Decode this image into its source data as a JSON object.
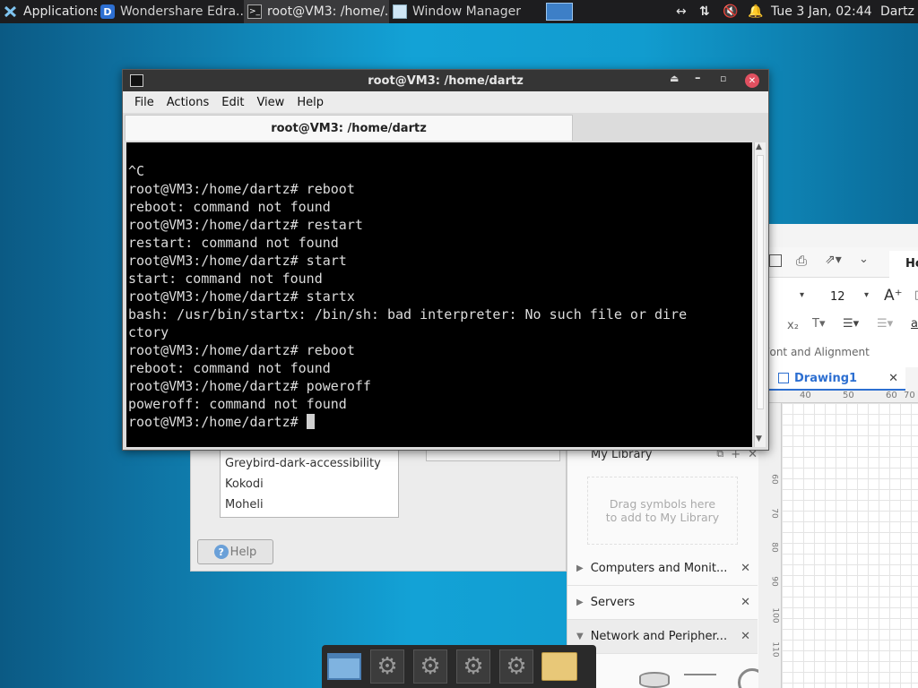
{
  "panel": {
    "applications": "Applications",
    "tasks": [
      {
        "label": "Wondershare Edra..."
      },
      {
        "label": "root@VM3: /home/..."
      },
      {
        "label": "Window Manager"
      }
    ],
    "clock": "Tue  3 Jan, 02:44",
    "user": "Dartz"
  },
  "terminal": {
    "window_title": "root@VM3: /home/dartz",
    "tab_title": "root@VM3: /home/dartz",
    "menu": [
      "File",
      "Actions",
      "Edit",
      "View",
      "Help"
    ],
    "lines": [
      "",
      "^C",
      "root@VM3:/home/dartz# reboot",
      "reboot: command not found",
      "root@VM3:/home/dartz# restart",
      "restart: command not found",
      "root@VM3:/home/dartz# start",
      "start: command not found",
      "root@VM3:/home/dartz# startx",
      "bash: /usr/bin/startx: /bin/sh: bad interpreter: No such file or dire",
      "ctory",
      "root@VM3:/home/dartz# reboot",
      "reboot: command not found",
      "root@VM3:/home/dartz# poweroff",
      "poweroff: command not found"
    ],
    "prompt": "root@VM3:/home/dartz# "
  },
  "appearance": {
    "themes": [
      "Greybird-dark-accessibility",
      "Kokodi",
      "Moheli"
    ],
    "help_label": "Help"
  },
  "edraw": {
    "font_size": "12",
    "font_section": "Font and Alignment",
    "doc_tab": "Drawing1",
    "home_tab": "Ho",
    "ruler_top": [
      "40",
      "50",
      "60",
      "70"
    ],
    "ruler_left": [
      "60",
      "70",
      "80",
      "90",
      "100",
      "110"
    ],
    "my_library": "My Library",
    "drag_hint": "Drag symbols here to add to My Library",
    "categories": [
      "Computers and Monit...",
      "Servers",
      "Network and Peripher..."
    ]
  }
}
